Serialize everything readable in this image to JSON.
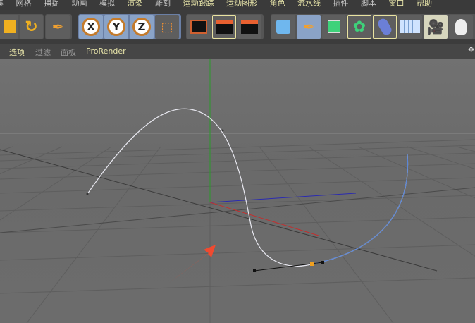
{
  "menu": {
    "items": [
      "集",
      "网格",
      "捕捉",
      "动画",
      "模拟",
      "渲染",
      "雕刻",
      "运动跟踪",
      "运动图形",
      "角色",
      "流水线",
      "插件",
      "脚本",
      "窗口",
      "帮助"
    ]
  },
  "toolbar": {
    "x": "X",
    "y": "Y",
    "z": "Z"
  },
  "viewport_menu": {
    "options": "选项",
    "filter": "过滤",
    "panel": "面板",
    "prorender": "ProRender"
  },
  "colors": {
    "accent": "#e6e3a8",
    "x_axis": "#c03030",
    "y_axis": "#2a9a2a",
    "z_axis": "#2a2ab0",
    "spline": "#e8e8f0",
    "spline_end": "#5b86d6",
    "arrow": "#f04a30"
  }
}
